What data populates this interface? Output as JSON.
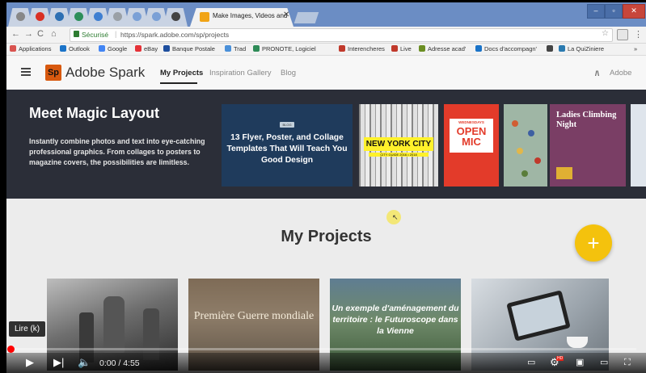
{
  "browser": {
    "active_tab_title": "Make Images, Videos and",
    "security_label": "Sécurisé",
    "url": "https://spark.adobe.com/sp/projects",
    "bookmarks": [
      {
        "label": "Applications",
        "icon": "apps-grid-icon",
        "color": "#d9534f"
      },
      {
        "label": "Outlook",
        "icon": "outlook-icon",
        "color": "#1a73c8"
      },
      {
        "label": "Google",
        "icon": "google-icon",
        "color": "#4285f4"
      },
      {
        "label": "eBay",
        "icon": "ebay-icon",
        "color": "#e53238"
      },
      {
        "label": "Banque Postale",
        "icon": "bank-icon",
        "color": "#1d4e9e"
      },
      {
        "label": "Trad",
        "icon": "translate-icon",
        "color": "#4a90d9"
      },
      {
        "label": "PRONOTE, Logiciel",
        "icon": "pronote-icon",
        "color": "#2e8b57"
      },
      {
        "label": "Interencheres",
        "icon": "interencheres-icon",
        "color": "#c0392b"
      },
      {
        "label": "Live",
        "icon": "live-icon",
        "color": "#c0392b"
      },
      {
        "label": "Adresse acad'",
        "icon": "school-icon",
        "color": "#6b8e23"
      },
      {
        "label": "Docs d'accompagn'",
        "icon": "docs-icon",
        "color": "#1a73c8"
      },
      {
        "label": "",
        "icon": "badge-icon",
        "color": "#444444"
      },
      {
        "label": "La QuiZiniere",
        "icon": "quiz-icon",
        "color": "#2a7ab0"
      }
    ]
  },
  "spark": {
    "brand_abbrev": "Sp",
    "brand_name": "Adobe Spark",
    "nav": [
      "My Projects",
      "Inspiration Gallery",
      "Blog"
    ],
    "adobe_label": "Adobe",
    "accent_color": "#d8590f"
  },
  "banner": {
    "title": "Meet Magic Layout",
    "description": "Instantly combine photos and text into eye-catching professional graphics. From collages to posters to magazine covers, the possibilities are limitless.",
    "cards": [
      {
        "tag": "BLOG",
        "text": "13 Flyer, Poster, and Collage Templates That Will Teach You Good Design"
      },
      {
        "text": "NEW YORK CITY",
        "sub": "CITY GUIDE 2016 • 2018"
      },
      {
        "small": "WEDNESDAYS",
        "big": "OPEN MIC"
      },
      {
        "text": ""
      },
      {
        "text": "Ladies Climbing Night"
      }
    ]
  },
  "projects": {
    "title": "My Projects",
    "add_button": "+",
    "fab_color": "#f4c20d",
    "items": [
      {
        "title": ""
      },
      {
        "title": "Première Guerre mondiale"
      },
      {
        "title": "Un exemple d'aménagement du territoire : le Futuroscope dans la Vienne"
      },
      {
        "title": ""
      }
    ]
  },
  "player": {
    "tooltip": "Lire (k)",
    "time_current": "0:00",
    "time_total": "4:55",
    "time_display": "0:00 / 4:55",
    "progress_fraction": 0.005,
    "hd_badge": "HD"
  }
}
